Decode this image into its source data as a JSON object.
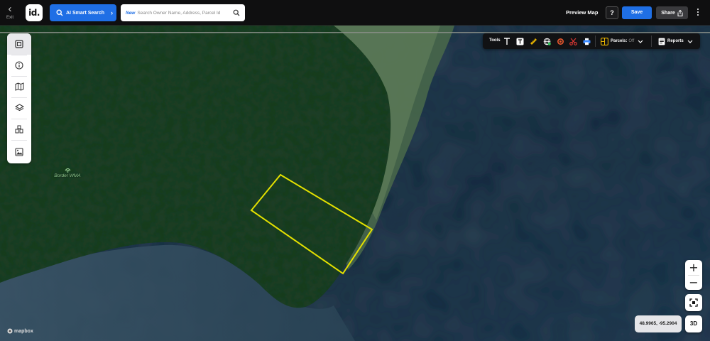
{
  "topbar": {
    "exit_label": "Exit",
    "logo_text": "id.",
    "ai_search_label": "AI Smart Search",
    "search_new_badge": "New",
    "search_placeholder": "Search Owner Name, Address, Parcel Id",
    "preview_label": "Preview Map",
    "help_label": "?",
    "save_label": "Save",
    "share_label": "Share"
  },
  "sidebar": {
    "items": [
      {
        "icon": "parcel-panel-icon"
      },
      {
        "icon": "info-icon"
      },
      {
        "icon": "map-icon"
      },
      {
        "icon": "layers-icon"
      },
      {
        "icon": "buildings-icon"
      },
      {
        "icon": "image-icon"
      }
    ]
  },
  "toolbar": {
    "tools_label": "Tools",
    "tools": [
      "text-tool-icon",
      "text-box-tool-icon",
      "ruler-icon",
      "globe-add-icon",
      "target-icon",
      "scissors-icon",
      "print-icon"
    ],
    "parcels_label": "Parcels:",
    "parcels_value": "Off",
    "reports_label": "Reports"
  },
  "map": {
    "poi_label": "Border WMA",
    "attribution": "mapbox",
    "coordinates": "48.9965, -95.2904",
    "zoom_in": "+",
    "zoom_out": "−",
    "view_3d_label": "3D"
  },
  "colors": {
    "accent": "#1f6fe5",
    "topbar_bg": "#0f0f10",
    "parcel_outline": "#e3e000",
    "water": "#14263a",
    "forest": "#24402a"
  }
}
